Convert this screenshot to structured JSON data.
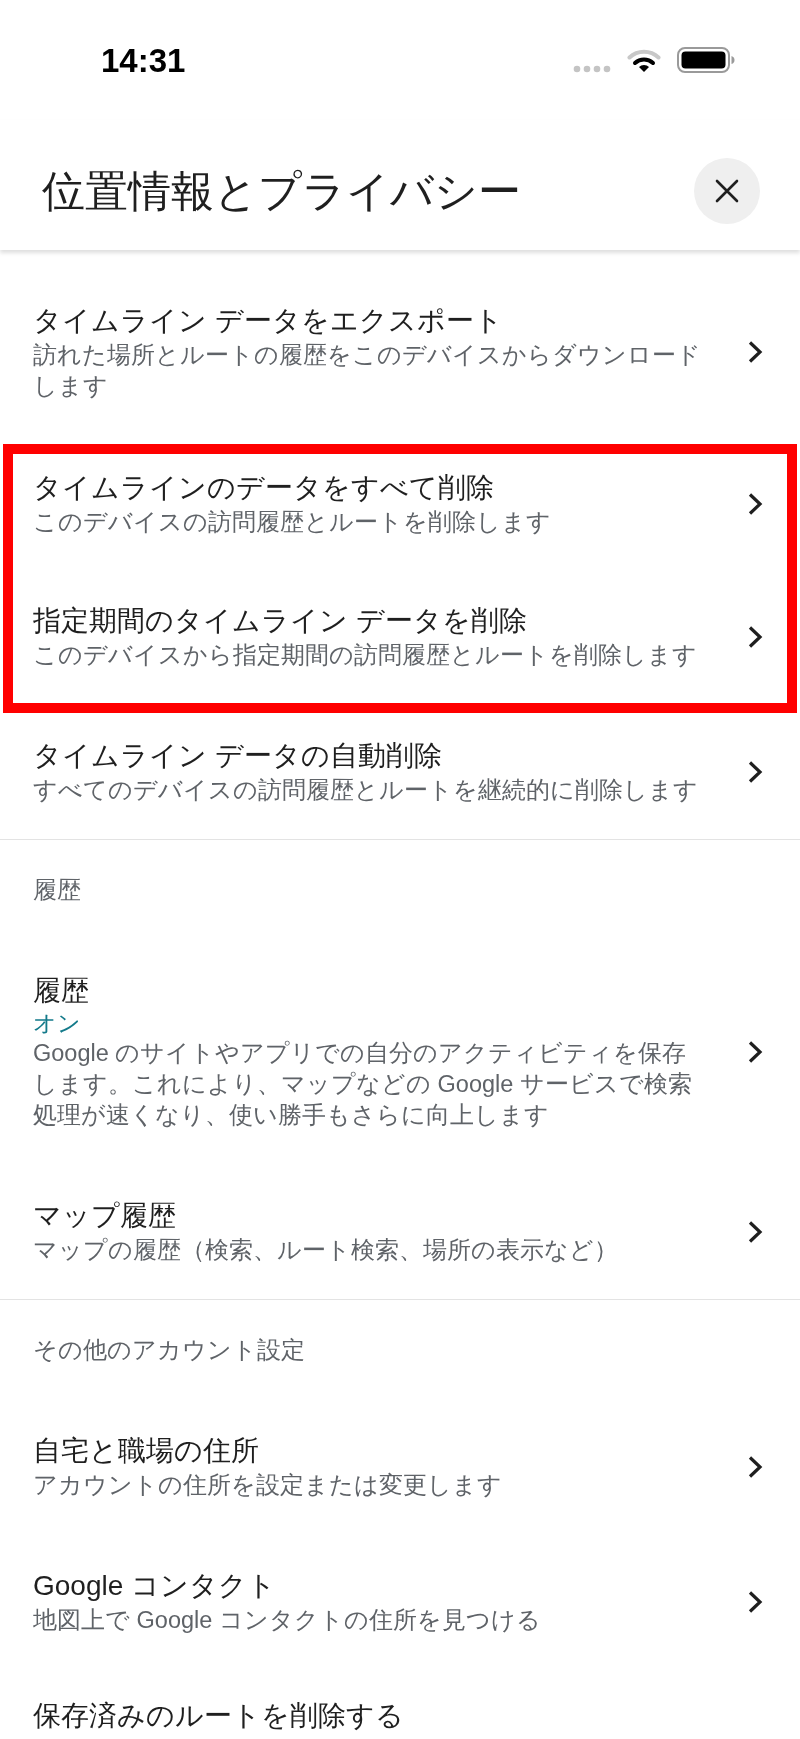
{
  "status_bar": {
    "time": "14:31"
  },
  "header": {
    "title": "位置情報とプライバシー"
  },
  "sections": [
    {
      "groups": [
        {
          "highlighted": false,
          "items": [
            {
              "title": "タイムライン データをエクスポート",
              "description": "訪れた場所とルートの履歴をこのデバイスからダウンロードします"
            }
          ]
        },
        {
          "highlighted": true,
          "items": [
            {
              "title": "タイムラインのデータをすべて削除",
              "description": "このデバイスの訪問履歴とルートを削除します"
            },
            {
              "title": "指定期間のタイムライン データを削除",
              "description": "このデバイスから指定期間の訪問履歴とルートを削除します"
            }
          ]
        },
        {
          "highlighted": false,
          "items": [
            {
              "title": "タイムライン データの自動削除",
              "description": "すべてのデバイスの訪問履歴とルートを継続的に削除します"
            }
          ]
        }
      ]
    },
    {
      "heading": "履歴",
      "groups": [
        {
          "highlighted": false,
          "items": [
            {
              "title": "履歴",
              "status": "オン",
              "description": "Google のサイトやアプリでの自分のアクティビティを保存します。これにより、マップなどの Google サービスで検索処理が速くなり、使い勝手もさらに向上します"
            },
            {
              "title": "マップ履歴",
              "description": "マップの履歴（検索、ルート検索、場所の表示など）"
            }
          ]
        }
      ]
    },
    {
      "heading": "その他のアカウント設定",
      "groups": [
        {
          "highlighted": false,
          "items": [
            {
              "title": "自宅と職場の住所",
              "description": "アカウントの住所を設定または変更します"
            },
            {
              "title": "Google コンタクト",
              "description": "地図上で Google コンタクトの住所を見つける"
            },
            {
              "title": "保存済みのルートを削除する"
            }
          ]
        }
      ]
    }
  ]
}
